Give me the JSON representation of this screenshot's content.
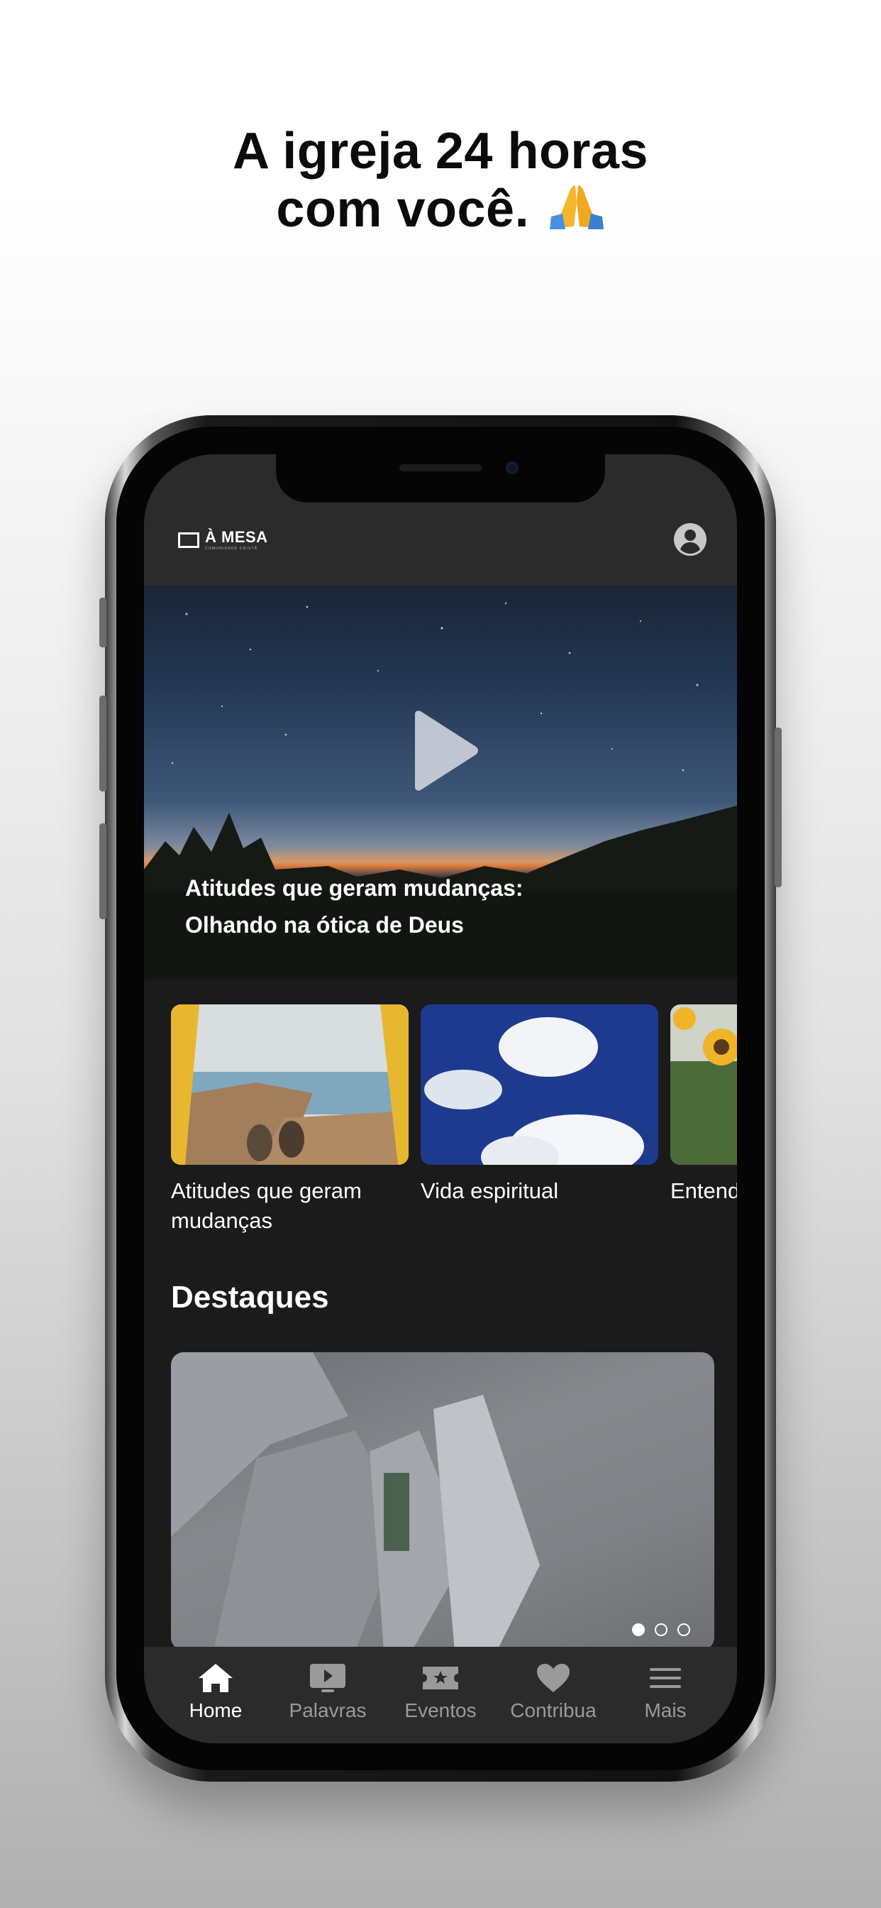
{
  "headline": {
    "line1": "A igreja 24 horas",
    "line2": "com você."
  },
  "header": {
    "logo_main": "À MESA",
    "logo_sub": "COMUNIDADE CRISTÃ"
  },
  "hero": {
    "title_line1": "Atitudes que geram mudanças:",
    "title_line2": "Olhando na ótica de Deus"
  },
  "cards": [
    {
      "title": "Atitudes que geram mudanças"
    },
    {
      "title": "Vida espiritual"
    },
    {
      "title": "Entenda os dons"
    }
  ],
  "section": {
    "title": "Destaques"
  },
  "carousel": {
    "count": 3,
    "active_index": 0
  },
  "tabs": [
    {
      "label": "Home",
      "icon": "home-icon",
      "active": true
    },
    {
      "label": "Palavras",
      "icon": "play-screen-icon",
      "active": false
    },
    {
      "label": "Eventos",
      "icon": "ticket-star-icon",
      "active": false
    },
    {
      "label": "Contribua",
      "icon": "heart-icon",
      "active": false
    },
    {
      "label": "Mais",
      "icon": "menu-icon",
      "active": false
    }
  ],
  "colors": {
    "app_bg": "#1b1b1b",
    "bar_bg": "#2b2b2b",
    "inactive": "#9a9a9a",
    "active": "#ffffff"
  }
}
